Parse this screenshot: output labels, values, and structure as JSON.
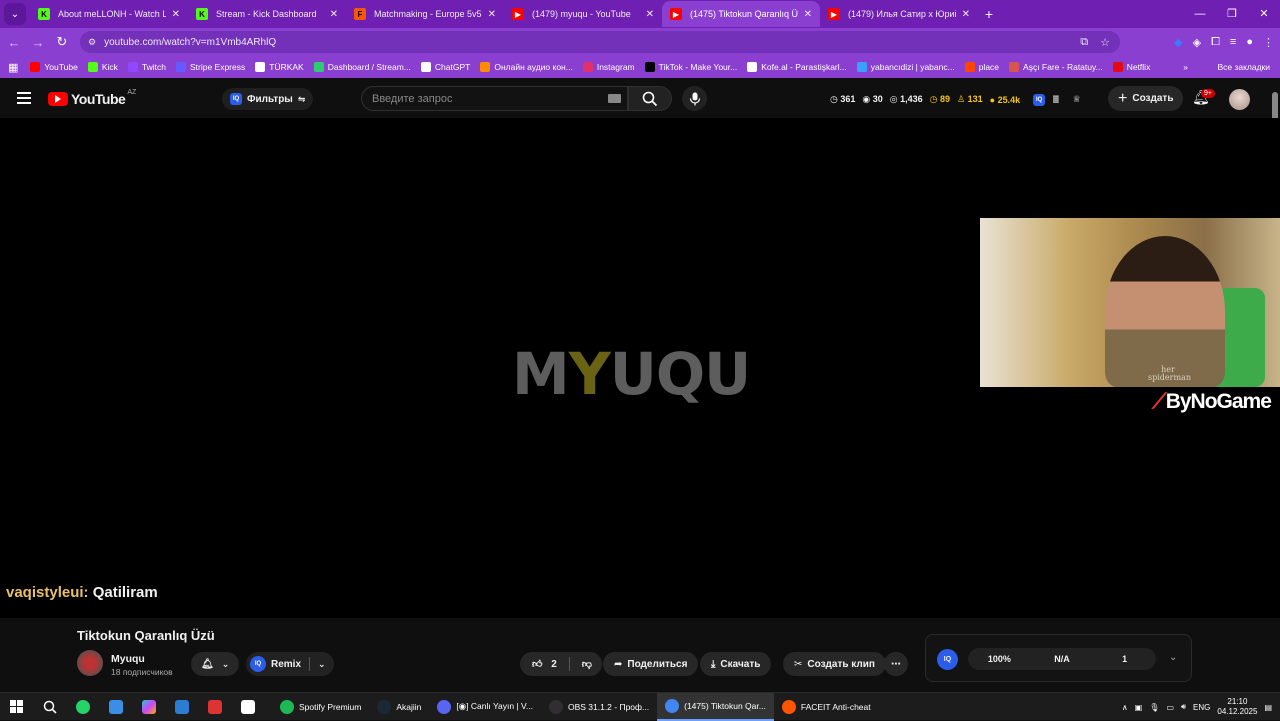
{
  "browser": {
    "tabs": [
      {
        "title": "About meLLONH - Watch Live o",
        "icon_color": "#53fc18",
        "icon": "K"
      },
      {
        "title": "Stream - Kick Dashboard",
        "icon_color": "#53fc18",
        "icon": "K"
      },
      {
        "title": "Matchmaking - Europe 5v5 Qu",
        "icon_color": "#ff5500",
        "icon": "F"
      },
      {
        "title": "(1479) myuqu - YouTube",
        "icon_color": "#ff0000",
        "icon": "▶"
      },
      {
        "title": "(1475) Tiktokun Qaranlıq Üzü -",
        "icon_color": "#ff0000",
        "icon": "▶",
        "active": true
      },
      {
        "title": "(1479) Илья Сатир x Юрий Гал",
        "icon_color": "#ff0000",
        "icon": "▶"
      }
    ],
    "url": "youtube.com/watch?v=m1Vmb4ARhlQ",
    "bookmarks": [
      {
        "label": "YouTube",
        "color": "#ff0000"
      },
      {
        "label": "Kick",
        "color": "#53fc18"
      },
      {
        "label": "Twitch",
        "color": "#9146ff"
      },
      {
        "label": "Stripe Express",
        "color": "#635bff"
      },
      {
        "label": "TÜRKAK",
        "color": "#ffffff"
      },
      {
        "label": "Dashboard / Stream...",
        "color": "#2ecc71"
      },
      {
        "label": "ChatGPT",
        "color": "#ffffff"
      },
      {
        "label": "Онлайн аудио кон...",
        "color": "#ff8c00"
      },
      {
        "label": "Instagram",
        "color": "#e1306c"
      },
      {
        "label": "TikTok - Make Your...",
        "color": "#000000"
      },
      {
        "label": "Kofe.al - Parastişkarl...",
        "color": "#ffffff"
      },
      {
        "label": "yabancıdizi | yabanc...",
        "color": "#3aa0ff"
      },
      {
        "label": "place",
        "color": "#ff4500"
      },
      {
        "label": "Aşçı Fare - Ratatuy...",
        "color": "#d9534f"
      },
      {
        "label": "Netflix",
        "color": "#e50914"
      }
    ],
    "all_bookmarks": "Все закладки"
  },
  "youtube": {
    "logo": "YouTube",
    "region": "AZ",
    "filters_label": "Фильтры",
    "search_placeholder": "Введите запрос",
    "stats": {
      "views": "361",
      "watchers": "30",
      "count": "1,436",
      "clocks": "89",
      "people": "131",
      "coins": "25.4k"
    },
    "create_label": "Создать",
    "notif_badge": "9+"
  },
  "video": {
    "watermark_left": "M",
    "watermark_y": "Y",
    "watermark_right": "UQU",
    "overlay_brand": "ByNoGame",
    "chat_user": "vaqistyleui:",
    "chat_message": "Qatiliram",
    "shirt_text": "her spiderman"
  },
  "details": {
    "title": "Tiktokun Qaranlıq Üzü",
    "channel": "Myuqu",
    "subscribers": "18 подписчиков",
    "remix": "Remix",
    "likes": "2",
    "share": "Поделиться",
    "download": "Скачать",
    "clip": "Создать клип"
  },
  "iq_panel": {
    "badge": "IQ",
    "v1": "100%",
    "v2": "N/A",
    "v3": "1"
  },
  "taskbar": {
    "apps": [
      {
        "label": "Spotify Premium",
        "color": "#1db954"
      },
      {
        "label": "Akajiin",
        "color": "#1b2838"
      },
      {
        "label": "[◉] Canlı Yayın | V...",
        "color": "#5865f2"
      },
      {
        "label": "OBS 31.1.2 - Проф...",
        "color": "#302e31"
      },
      {
        "label": "(1475) Tiktokun Qar...",
        "color": "#4285f4",
        "active": true
      },
      {
        "label": "FACEIT Anti-cheat",
        "color": "#ff5500"
      }
    ],
    "lang": "ENG",
    "time": "21:10",
    "date": "04.12.2025"
  }
}
